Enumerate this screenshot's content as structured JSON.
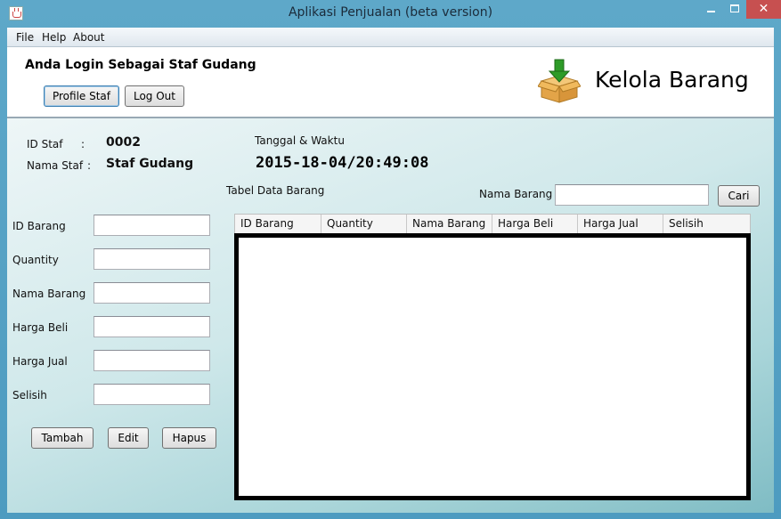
{
  "window": {
    "title": "Aplikasi Penjualan (beta version)",
    "close_glyph": "✕"
  },
  "menu": [
    "File",
    "Help",
    "About"
  ],
  "header": {
    "login_text": "Anda Login Sebagai Staf Gudang",
    "profile_button": "Profile Staf",
    "logout_button": "Log Out",
    "page_heading": "Kelola Barang",
    "heading_icon": "box-download-icon"
  },
  "staff": {
    "id_label": "ID Staf",
    "id_separator": ":",
    "id_value": "0002",
    "name_label": "Nama Staf",
    "name_separator": ":",
    "name_value": "Staf Gudang"
  },
  "datetime": {
    "label": "Tanggal & Waktu",
    "value": "2015-18-04/20:49:08"
  },
  "form": {
    "fields": [
      {
        "label": "ID Barang",
        "value": ""
      },
      {
        "label": "Quantity",
        "value": ""
      },
      {
        "label": "Nama Barang",
        "value": ""
      },
      {
        "label": "Harga Beli",
        "value": ""
      },
      {
        "label": "Harga Jual",
        "value": ""
      },
      {
        "label": "Selisih",
        "value": ""
      }
    ],
    "add_button": "Tambah",
    "edit_button": "Edit",
    "delete_button": "Hapus"
  },
  "search": {
    "table_title": "Tabel Data Barang",
    "label": "Nama Barang",
    "value": "",
    "button": "Cari"
  },
  "table": {
    "columns": [
      "ID Barang",
      "Quantity",
      "Nama Barang",
      "Harga Beli",
      "Harga Jual",
      "Selisih"
    ],
    "rows": []
  },
  "colors": {
    "window_frame": "#4d9bc0",
    "close_button": "#c75050",
    "icon_arrow": "#2e9b28",
    "icon_box": "#e0a94a"
  }
}
